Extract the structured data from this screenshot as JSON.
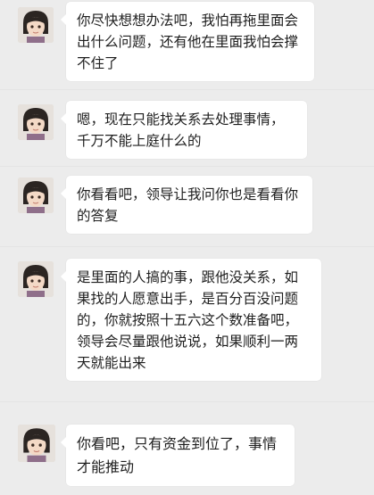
{
  "messages": [
    {
      "text": "你尽快想想办法吧，我怕再拖里面会出什么问题，还有他在里面我怕会撑不住了"
    },
    {
      "text": "嗯，现在只能找关系去处理事情，千万不能上庭什么的"
    },
    {
      "text": "你看看吧，领导让我问你也是看看你的答复"
    },
    {
      "text": "是里面的人搞的事，跟他没关系，如果找的人愿意出手，是百分百没问题的，你就按照十五六这个数准备吧，领导会尽量跟他说说，如果顺利一两天就能出来"
    },
    {
      "text": "你看吧，只有资金到位了，事情才能推动"
    }
  ],
  "colors": {
    "background": "#ececec",
    "bubble": "#ffffff",
    "text": "#1e1e1e"
  },
  "icons": {
    "avatar": "avatar-cartoon-girl-icon"
  }
}
